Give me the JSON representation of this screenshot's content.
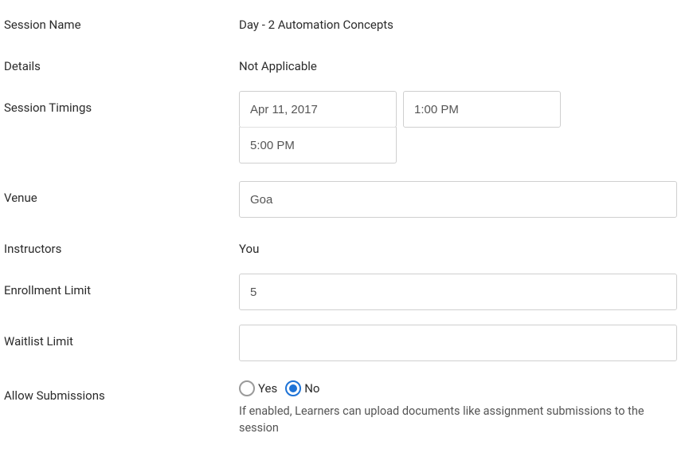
{
  "labels": {
    "session_name": "Session Name",
    "details": "Details",
    "session_timings": "Session Timings",
    "venue": "Venue",
    "instructors": "Instructors",
    "enrollment_limit": "Enrollment Limit",
    "waitlist_limit": "Waitlist Limit",
    "allow_submissions": "Allow Submissions"
  },
  "values": {
    "session_name": "Day - 2 Automation Concepts",
    "details": "Not Applicable",
    "date": "Apr 11, 2017",
    "start_time": "1:00 PM",
    "end_time": "5:00 PM",
    "venue": "Goa",
    "instructors": "You",
    "enrollment_limit": "5",
    "waitlist_limit": ""
  },
  "allow_submissions": {
    "options": {
      "yes": "Yes",
      "no": "No"
    },
    "selected": "no",
    "helper": "If enabled, Learners can upload documents like assignment submissions to the session"
  }
}
